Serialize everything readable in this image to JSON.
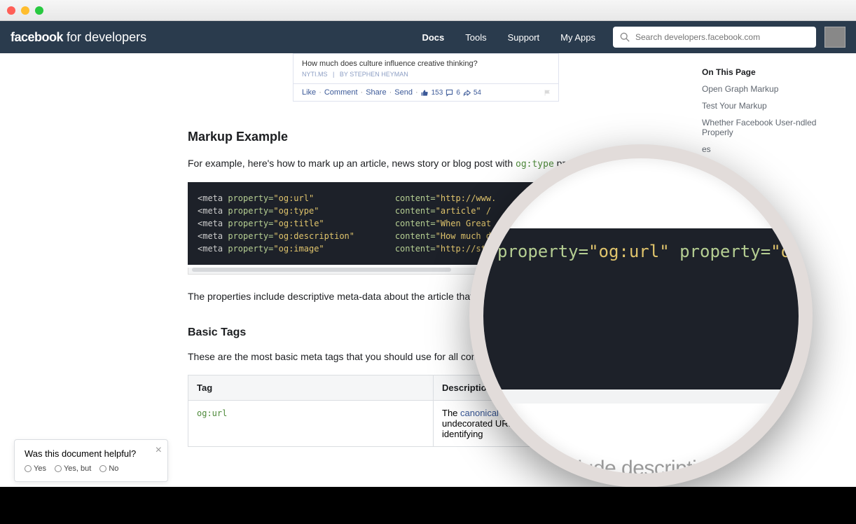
{
  "window": {
    "title": ""
  },
  "navbar": {
    "logo_bold": "facebook",
    "logo_light": "for developers",
    "links": [
      "Docs",
      "Tools",
      "Support",
      "My Apps"
    ],
    "search_placeholder": "Search developers.facebook.com"
  },
  "sidebar": {
    "heading": "On This Page",
    "items": [
      "Open Graph Markup",
      "Test Your Markup",
      "Whether Facebook User-ndled Properly",
      "es"
    ]
  },
  "fb_card": {
    "question": "How much does culture influence creative thinking?",
    "source": "NYTI.MS",
    "byline": "BY STEPHEN HEYMAN",
    "actions": [
      "Like",
      "Comment",
      "Share",
      "Send"
    ],
    "likes": "153",
    "comments": "6",
    "shares": "54"
  },
  "section1": {
    "heading": "Markup Example",
    "para1_pre": "For example, here's how to mark up an article, news story or blog post with ",
    "para1_code": "og:type",
    "para1_post": " properties:"
  },
  "code": {
    "lines": [
      {
        "prop": "og:url",
        "content": "http://www."
      },
      {
        "prop": "og:type",
        "content": "article"
      },
      {
        "prop": "og:title",
        "content": "When Great"
      },
      {
        "prop": "og:description",
        "content": "How much d"
      },
      {
        "prop": "og:image",
        "content": "http://sta"
      }
    ]
  },
  "para2": "The properties include descriptive meta-data about the article that we spec shares the article.",
  "section2": {
    "heading": "Basic Tags",
    "para": "These are the most basic meta tags that you should use for all content types:"
  },
  "table": {
    "headers": [
      "Tag",
      "Description"
    ],
    "rows": [
      {
        "tag": "og:url",
        "desc_pre": "The ",
        "desc_link": "canonical URL",
        "desc_post": " for your page. This should be the undecorated URL, without session variables, user identifying"
      }
    ]
  },
  "magnifier": {
    "props": [
      "og:url",
      "og:type",
      "og:title",
      "og:description",
      "og:image"
    ],
    "bottom_text": "clude descripti"
  },
  "feedback": {
    "question": "Was this document helpful?",
    "opts": [
      "Yes",
      "Yes, but",
      "No"
    ]
  }
}
